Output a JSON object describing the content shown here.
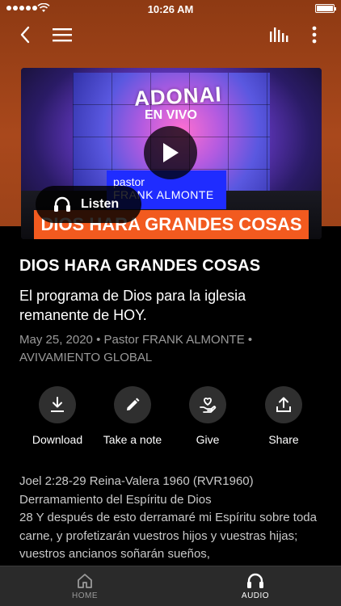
{
  "status_bar": {
    "time": "10:26 AM"
  },
  "nav": {
    "back_icon": "chevron-left-icon",
    "menu_icon": "hamburger-icon",
    "audio_bars_icon": "audio-bars-icon",
    "more_icon": "more-vertical-icon"
  },
  "media": {
    "thumbnail_text": {
      "adonai": "ADONAI",
      "en_vivo": "EN VIVO",
      "pastor_line1": "pastor",
      "pastor_line2": "FRANK ALMONTE",
      "banner": "DIOS HARA GRANDES COSAS"
    },
    "listen_label": "Listen"
  },
  "sermon": {
    "title": "DIOS HARA GRANDES COSAS",
    "subtitle": "El programa de Dios para la iglesia remanente de HOY.",
    "date": "May 25, 2020",
    "speaker": "Pastor FRANK ALMONTE",
    "series": "AVIVAMIENTO GLOBAL"
  },
  "actions": [
    {
      "label": "Download",
      "icon": "download-icon"
    },
    {
      "label": "Take a note",
      "icon": "pencil-icon"
    },
    {
      "label": "Give",
      "icon": "give-heart-hand-icon"
    },
    {
      "label": "Share",
      "icon": "share-icon"
    }
  ],
  "scripture": {
    "reference": "Joel 2:28-29 Reina-Valera 1960 (RVR1960)",
    "heading": "Derramamiento del Espíritu de Dios",
    "text": "28 Y después de esto derramaré mi Espíritu sobre toda carne, y profetizarán vuestros hijos y vuestras hijas; vuestros ancianos soñarán sueños,"
  },
  "tabbar": {
    "tabs": [
      {
        "label": "HOME",
        "icon": "home-icon",
        "active": false
      },
      {
        "label": "AUDIO",
        "icon": "headphones-icon",
        "active": true
      }
    ]
  },
  "colors": {
    "hero_bg": "#a9481c",
    "banner_orange": "#f25a1f",
    "pastor_blue": "#1f2cff",
    "tabbar_bg": "#2a2a2a"
  }
}
